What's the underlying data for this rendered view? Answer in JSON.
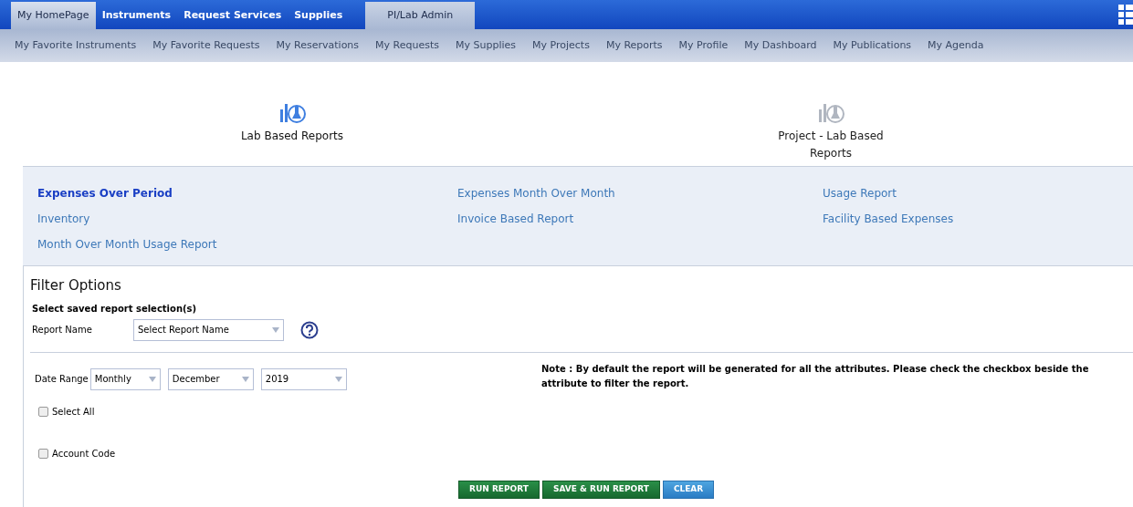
{
  "top_tabs": [
    {
      "label": "My HomePage",
      "kind": "light",
      "selected": true
    },
    {
      "label": "Instruments",
      "kind": "blue",
      "selected": false
    },
    {
      "label": "Request Services",
      "kind": "blue",
      "selected": false
    },
    {
      "label": "Supplies",
      "kind": "blue",
      "selected": false
    },
    {
      "label": "PI/Lab Admin",
      "kind": "light",
      "selected": false
    }
  ],
  "sub_nav": [
    "My Favorite Instruments",
    "My Favorite Requests",
    "My Reservations",
    "My Requests",
    "My Supplies",
    "My Projects",
    "My Reports",
    "My Profile",
    "My Dashboard",
    "My Publications",
    "My Agenda"
  ],
  "report_types": [
    {
      "label": "Lab Based Reports",
      "selected": true
    },
    {
      "label": "Project - Lab Based Reports",
      "selected": false
    }
  ],
  "reports": [
    {
      "label": "Expenses Over Period",
      "selected": true
    },
    {
      "label": "Expenses Month Over Month",
      "selected": false
    },
    {
      "label": "Usage Report",
      "selected": false
    },
    {
      "label": "Inventory",
      "selected": false
    },
    {
      "label": "Invoice Based Report",
      "selected": false
    },
    {
      "label": "Facility Based Expenses",
      "selected": false
    },
    {
      "label": "Month Over Month Usage Report",
      "selected": false
    }
  ],
  "filter": {
    "title": "Filter Options",
    "saved_heading": "Select saved report selection(s)",
    "report_name_label": "Report Name",
    "report_name_placeholder": "Select Report Name",
    "date_range_label": "Date Range",
    "date_range": [
      "Monthly",
      "December",
      "2019"
    ],
    "note": "**Note :** **By default the report will be generated for all the attributes. Please check the checkbox beside the attribute to filter the report.**",
    "checkboxes": [
      {
        "label": "Select All",
        "checked": false
      },
      {
        "label": "Account Code",
        "checked": false
      }
    ]
  },
  "buttons": [
    {
      "label": "RUN REPORT",
      "kind": "green"
    },
    {
      "label": "SAVE & RUN REPORT",
      "kind": "green"
    },
    {
      "label": "CLEAR",
      "kind": "blue"
    }
  ]
}
